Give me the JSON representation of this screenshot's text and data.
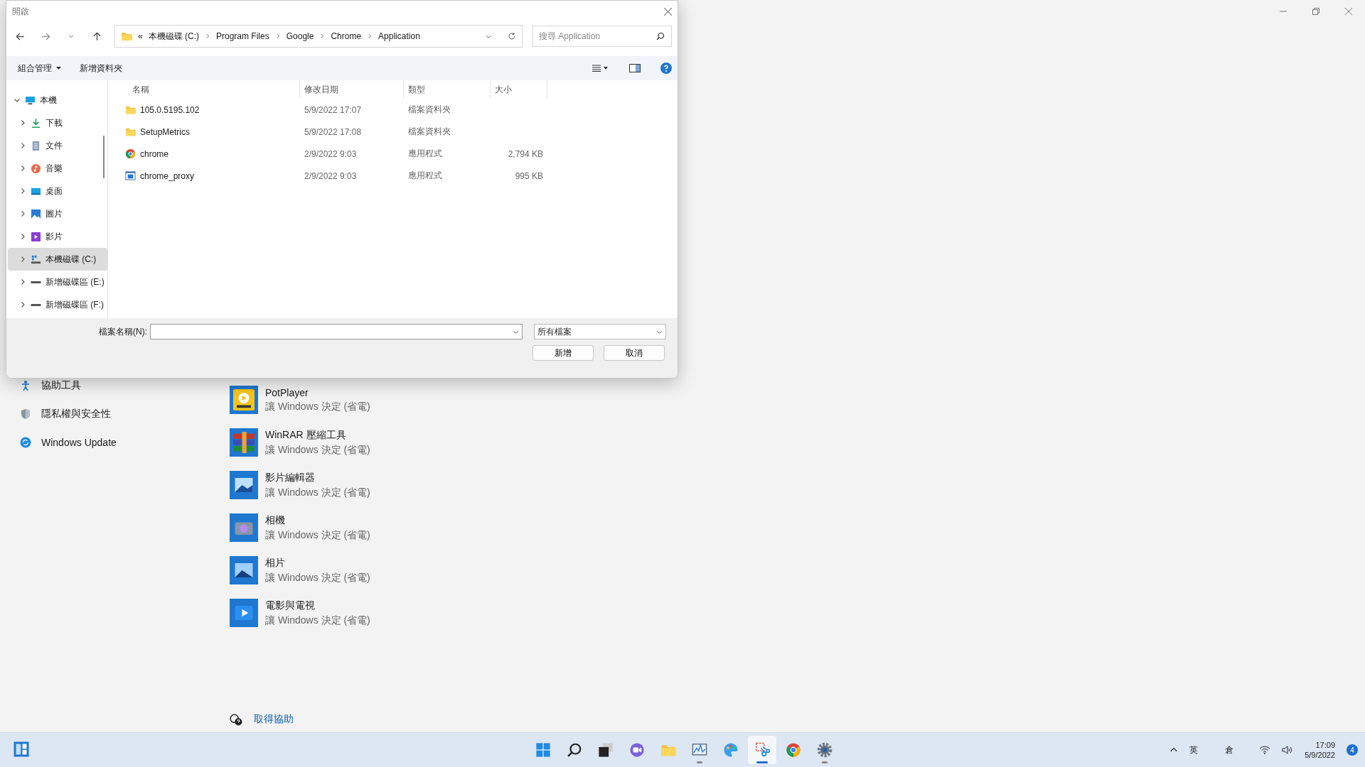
{
  "settings": {
    "nav_items": [
      {
        "label": "協助工具",
        "kind": "accessibility"
      },
      {
        "label": "隱私權與安全性",
        "kind": "shield"
      },
      {
        "label": "Windows Update",
        "kind": "update"
      }
    ],
    "apps": [
      {
        "name": "PotPlayer",
        "mode": "讓 Windows 決定 (省電)",
        "kind": "player"
      },
      {
        "name": "WinRAR 壓縮工具",
        "mode": "讓 Windows 決定 (省電)",
        "kind": "archive"
      },
      {
        "name": "影片編輯器",
        "mode": "讓 Windows 決定 (省電)",
        "kind": "video-editor"
      },
      {
        "name": "相機",
        "mode": "讓 Windows 決定 (省電)",
        "kind": "camera"
      },
      {
        "name": "相片",
        "mode": "讓 Windows 決定 (省電)",
        "kind": "photos"
      },
      {
        "name": "電影與電視",
        "mode": "讓 Windows 決定 (省電)",
        "kind": "movies"
      }
    ],
    "help_link": "取得協助"
  },
  "dialog": {
    "title": "開啟",
    "overflow": "«",
    "breadcrumb": [
      "本機磁碟 (C:)",
      "Program Files",
      "Google",
      "Chrome",
      "Application"
    ],
    "search": {
      "placeholder": "搜尋 Application"
    },
    "toolbar": [
      {
        "label": "組合管理",
        "dropdown": true
      },
      {
        "label": "新增資料夾",
        "dropdown": false
      }
    ],
    "tree": [
      {
        "label": "本機",
        "kind": "pc",
        "expanded": true,
        "selected": false,
        "children": [
          {
            "label": "下載",
            "kind": "download",
            "expanded": false,
            "selected": false
          },
          {
            "label": "文件",
            "kind": "docs",
            "expanded": false,
            "selected": false
          },
          {
            "label": "音樂",
            "kind": "music",
            "expanded": false,
            "selected": false
          },
          {
            "label": "桌面",
            "kind": "desktop",
            "expanded": false,
            "selected": false
          },
          {
            "label": "圖片",
            "kind": "pictures",
            "expanded": false,
            "selected": false
          },
          {
            "label": "影片",
            "kind": "videos",
            "expanded": false,
            "selected": false
          },
          {
            "label": "本機磁碟 (C:)",
            "kind": "system-drive",
            "expanded": false,
            "selected": true
          },
          {
            "label": "新增磁碟區 (E:)",
            "kind": "drive",
            "expanded": false,
            "selected": false
          },
          {
            "label": "新增磁碟區 (F:)",
            "kind": "drive",
            "expanded": false,
            "selected": false
          }
        ]
      }
    ],
    "columns": [
      "名稱",
      "修改日期",
      "類型",
      "大小"
    ],
    "files": [
      {
        "name": "105.0.5195.102",
        "date": "5/9/2022 17:07",
        "type": "檔案資料夾",
        "kind": "folder"
      },
      {
        "name": "SetupMetrics",
        "date": "5/9/2022 17:08",
        "type": "檔案資料夾",
        "kind": "folder"
      },
      {
        "name": "chrome",
        "date": "2/9/2022 9:03",
        "type": "應用程式",
        "size": "2,794 KB",
        "kind": "browser"
      },
      {
        "name": "chrome_proxy",
        "date": "2/9/2022 9:03",
        "type": "應用程式",
        "size": "995 KB",
        "kind": "program"
      }
    ],
    "filename_label": "檔案名稱(N):",
    "filetype": "所有檔案",
    "buttons": [
      "新增",
      "取消"
    ]
  },
  "taskbar": {
    "apps": [
      {
        "kind": "start",
        "running": false,
        "selected": false
      },
      {
        "kind": "search",
        "running": false,
        "selected": false
      },
      {
        "kind": "task-view",
        "running": false,
        "selected": false
      },
      {
        "kind": "chat",
        "running": false,
        "selected": false
      },
      {
        "kind": "folder",
        "running": false,
        "selected": false
      },
      {
        "kind": "monitor",
        "running": true,
        "selected": false
      },
      {
        "kind": "palette",
        "running": false,
        "selected": false
      },
      {
        "kind": "snip",
        "running": true,
        "selected": true
      },
      {
        "kind": "browser",
        "running": false,
        "selected": false
      },
      {
        "kind": "gear",
        "running": true,
        "selected": false
      }
    ],
    "language": "英",
    "ime": "倉",
    "time": "17:09",
    "date": "5/9/2022",
    "notifications": "4"
  }
}
